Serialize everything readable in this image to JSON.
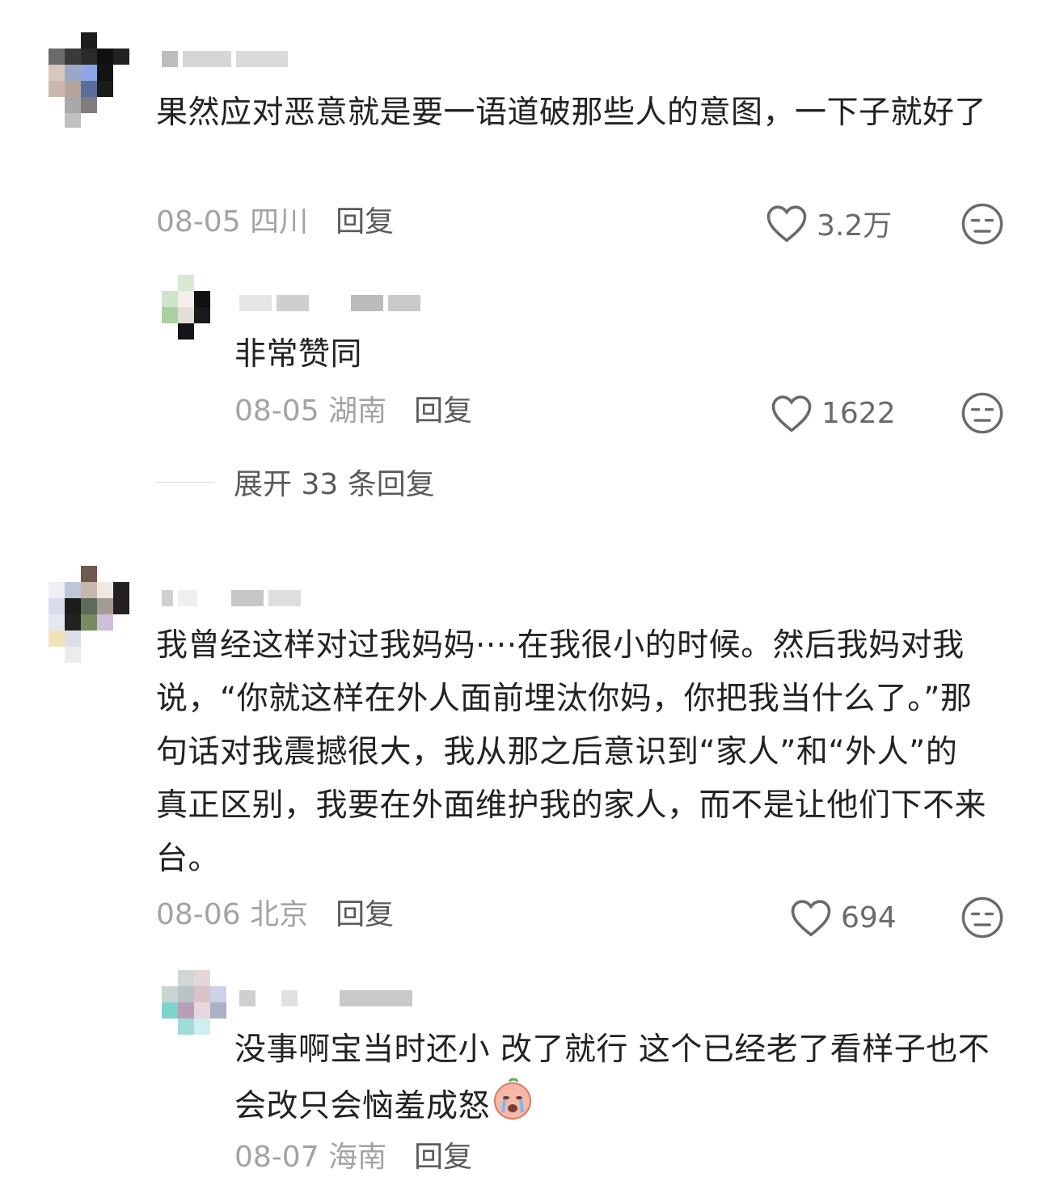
{
  "comments": [
    {
      "text": "果然应对恶意就是要一语道破那些人的意图，一下子就好了",
      "date": "08-05",
      "location": "四川",
      "reply_label": "回复",
      "likes": "3.2万"
    },
    {
      "text": "非常赞同",
      "date": "08-05",
      "location": "湖南",
      "reply_label": "回复",
      "likes": "1622"
    },
    {
      "text": "我曾经这样对过我妈妈····在我很小的时候。然后我妈对我说，“你就这样在外人面前埋汰你妈，你把我当什么了。”那句话对我震撼很大，我从那之后意识到“家人”和“外人”的真正区别，我要在外面维护我的家人，而不是让他们下不来台。",
      "date": "08-06",
      "location": "北京",
      "reply_label": "回复",
      "likes": "694"
    },
    {
      "text": "没事啊宝当时还小 改了就行 这个已经老了看样子也不会改只会恼羞成怒",
      "date": "08-07",
      "location": "海南",
      "reply_label": "回复"
    }
  ],
  "expand_replies": "展开 33 条回复",
  "icons": {
    "like": "heart-outline-icon",
    "dislike": "unamused-face-icon",
    "emoji": "crying-face-emoji"
  },
  "colors": {
    "text": "#222222",
    "meta": "#a3a3a3",
    "reply": "#5a5a5a",
    "icon": "#6a6a6a"
  }
}
